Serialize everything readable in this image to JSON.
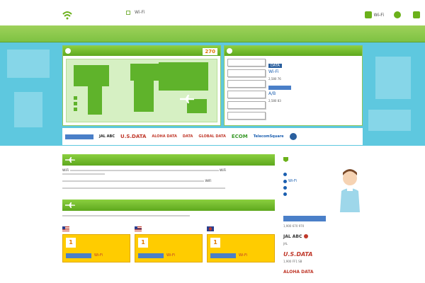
{
  "header": {
    "tagline": "",
    "site_name": "",
    "description_prefix": "",
    "description_highlight": "Wi-Fi",
    "description_suffix": "",
    "top_links": "",
    "nav": [
      {
        "label": "Wi-Fi",
        "icon": "wifi-icon"
      },
      {
        "label": "",
        "icon": "calendar-icon"
      },
      {
        "label": "",
        "icon": "people-icon"
      }
    ]
  },
  "map_panel": {
    "title": "",
    "country_count_prefix": "",
    "country_count_highlight": "",
    "country_count_value": "270",
    "legend": [
      "",
      "",
      ""
    ]
  },
  "data_panel": {
    "title": "",
    "buttons": [
      "",
      "",
      "",
      "",
      "",
      ""
    ],
    "tag": "DATA",
    "items": [
      {
        "title": "Wi-Fi",
        "date": "",
        "desc_a": "2,580",
        "desc_b": "76"
      },
      {
        "title": "A/B",
        "date": "",
        "desc_a": "2,580",
        "desc_b": "83"
      }
    ]
  },
  "partners": [
    "",
    "JAL ABC",
    "U.S.DATA",
    "ALOHA DATA",
    "DATA",
    "GLOBAL DATA",
    "ECOM",
    "TelecomSquare",
    ""
  ],
  "section_intro": {
    "title": "",
    "paragraphs": [
      {
        "a": "WiFi",
        "b": "WiFi"
      },
      {
        "a": "WiFi",
        "b": ""
      },
      {
        "a": "",
        "b": ""
      }
    ]
  },
  "section_ranking": {
    "title": "",
    "link": "",
    "subtitle": "",
    "cards": [
      {
        "country": "",
        "rank": "1",
        "currency": "",
        "provider": "Wi-Fi"
      },
      {
        "country": "",
        "rank": "1",
        "currency": "",
        "provider": "Wi-Fi"
      },
      {
        "country": "",
        "rank": "1",
        "currency": "",
        "provider": "Wi-Fi"
      }
    ]
  },
  "sidebar": {
    "title": "",
    "intro": "",
    "links": [
      "",
      "Wi-Fi",
      "",
      ""
    ],
    "providers": [
      {
        "name": "",
        "desc": "1,900 670 970"
      },
      {
        "name": "JAL ABC",
        "desc": "JAL"
      },
      {
        "name": "U.S.DATA",
        "desc": "1,900 FF1 SB"
      },
      {
        "name": "ALOHA DATA",
        "desc": ""
      }
    ]
  },
  "colors": {
    "brand_green": "#6bb11a",
    "sky": "#5ec8df",
    "accent_orange": "#e07a00",
    "card_yellow": "#ffcc00"
  }
}
